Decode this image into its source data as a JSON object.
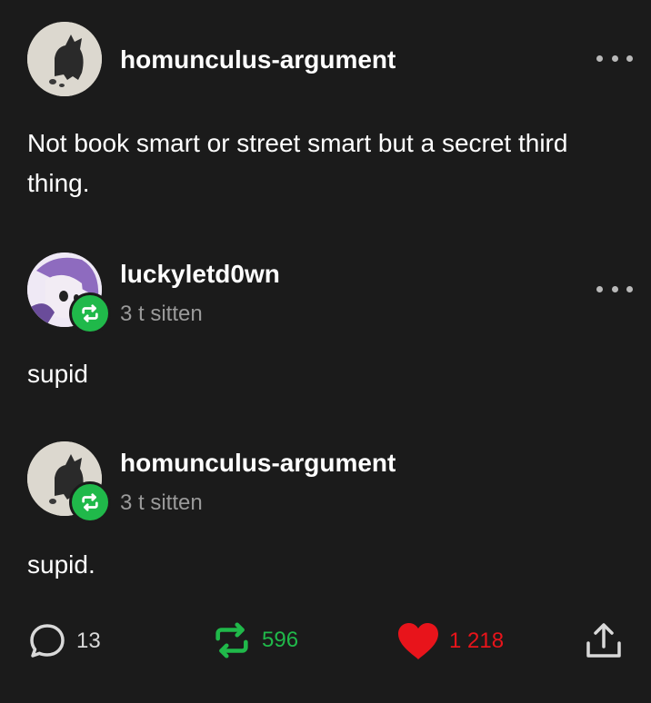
{
  "post": {
    "author": "homunculus-argument",
    "text": "Not book smart or street smart but a secret third thing."
  },
  "reblogs": [
    {
      "username": "luckyletd0wn",
      "time": "3 t sitten",
      "text": "supid"
    },
    {
      "username": "homunculus-argument",
      "time": "3 t sitten",
      "text": "supid."
    }
  ],
  "footer": {
    "comments_count": "13",
    "reblogs_count": "596",
    "likes_count": "1 218"
  },
  "colors": {
    "background": "#1b1b1b",
    "reblog_green": "#20b94a",
    "like_red": "#e8141b"
  },
  "icons": [
    "more-icon",
    "reblog-icon",
    "comment-icon",
    "heart-icon",
    "share-icon"
  ]
}
